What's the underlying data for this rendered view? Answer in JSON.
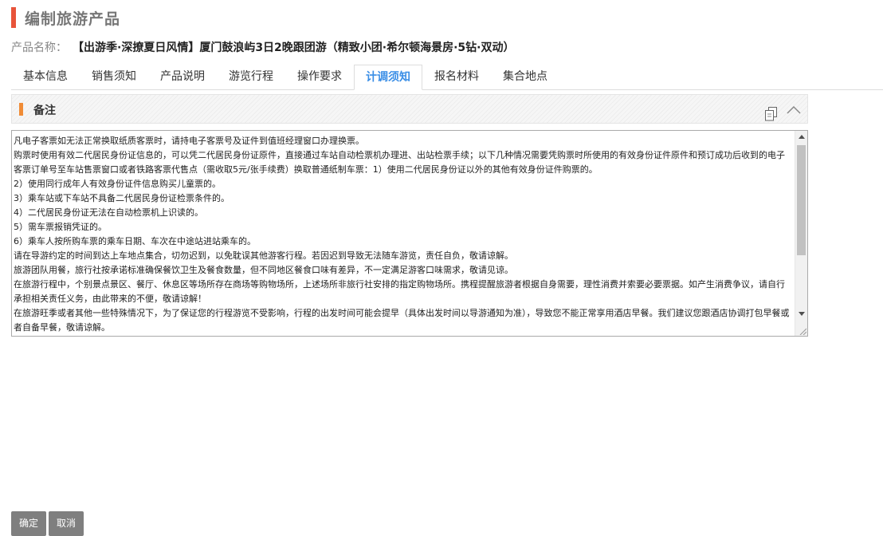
{
  "page": {
    "title": "编制旅游产品"
  },
  "product": {
    "label": "产品名称：",
    "name": "【出游季·深撩夏日风情】厦门鼓浪屿3日2晚跟团游（精致小团·希尔顿海景房·5钻·双动）"
  },
  "tabs": [
    {
      "label": "基本信息"
    },
    {
      "label": "销售须知"
    },
    {
      "label": "产品说明"
    },
    {
      "label": "游览行程"
    },
    {
      "label": "操作要求"
    },
    {
      "label": "计调须知",
      "active": true
    },
    {
      "label": "报名材料"
    },
    {
      "label": "集合地点"
    }
  ],
  "section": {
    "title": "备注",
    "copy_icon": "copy-icon",
    "collapse_icon": "chevron-up-icon"
  },
  "notes": [
    "凡电子客票如无法正常换取纸质客票时，请持电子客票号及证件到值班经理窗口办理换票。",
    "购票时使用有效二代居民身份证信息的，可以凭二代居民身份证原件，直接通过车站自动检票机办理进、出站检票手续；以下几种情况需要凭购票时所使用的有效身份证件原件和预订成功后收到的电子客票订单号至车站售票窗口或者铁路客票代售点（需收取5元/张手续费）换取普通纸制车票：1）使用二代居民身份证以外的其他有效身份证件购票的。",
    "2）使用同行成年人有效身份证件信息购买儿童票的。",
    "3）乘车站或下车站不具备二代居民身份证检票条件的。",
    "4）二代居民身份证无法在自动检票机上识读的。",
    "5）需车票报销凭证的。",
    "6）乘车人按所购车票的乘车日期、车次在中途站进站乘车的。",
    "请在导游约定的时间到达上车地点集合，切勿迟到，以免耽误其他游客行程。若因迟到导致无法随车游览，责任自负，敬请谅解。",
    "旅游团队用餐，旅行社按承诺标准确保餐饮卫生及餐食数量，但不同地区餐食口味有差异，不一定满足游客口味需求，敬请见谅。",
    "在旅游行程中，个别景点景区、餐厅、休息区等场所存在商场等购物场所，上述场所非旅行社安排的指定购物场所。携程提醒旅游者根据自身需要，理性消费并索要必要票据。如产生消费争议，请自行承担相关责任义务，由此带来的不便，敬请谅解！",
    "在旅游旺季或者其他一些特殊情况下，为了保证您的行程游览不受影响，行程的出发时间可能会提早（具体出发时间以导游通知为准），导致您不能正常享用酒店早餐。我们建议您跟酒店协调打包早餐或者自备早餐，敬请谅解。"
  ],
  "buttons": {
    "confirm": "确定",
    "cancel": "取消"
  }
}
